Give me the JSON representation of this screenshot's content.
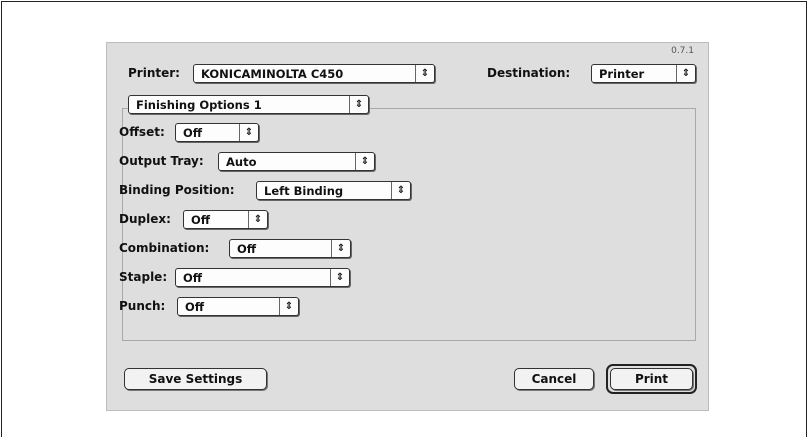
{
  "version": "0.7.1",
  "printer": {
    "label": "Printer:",
    "value": "KONICAMINOLTA C450"
  },
  "destination": {
    "label": "Destination:",
    "value": "Printer"
  },
  "panel": {
    "value": "Finishing Options 1"
  },
  "options": {
    "offset": {
      "label": "Offset:",
      "value": "Off"
    },
    "output_tray": {
      "label": "Output Tray:",
      "value": "Auto"
    },
    "binding_position": {
      "label": "Binding Position:",
      "value": "Left Binding"
    },
    "duplex": {
      "label": "Duplex:",
      "value": "Off"
    },
    "combination": {
      "label": "Combination:",
      "value": "Off"
    },
    "staple": {
      "label": "Staple:",
      "value": "Off"
    },
    "punch": {
      "label": "Punch:",
      "value": "Off"
    }
  },
  "buttons": {
    "save": "Save Settings",
    "cancel": "Cancel",
    "print": "Print"
  },
  "icons": {
    "popup_arrows": "up-down-arrows-icon"
  }
}
